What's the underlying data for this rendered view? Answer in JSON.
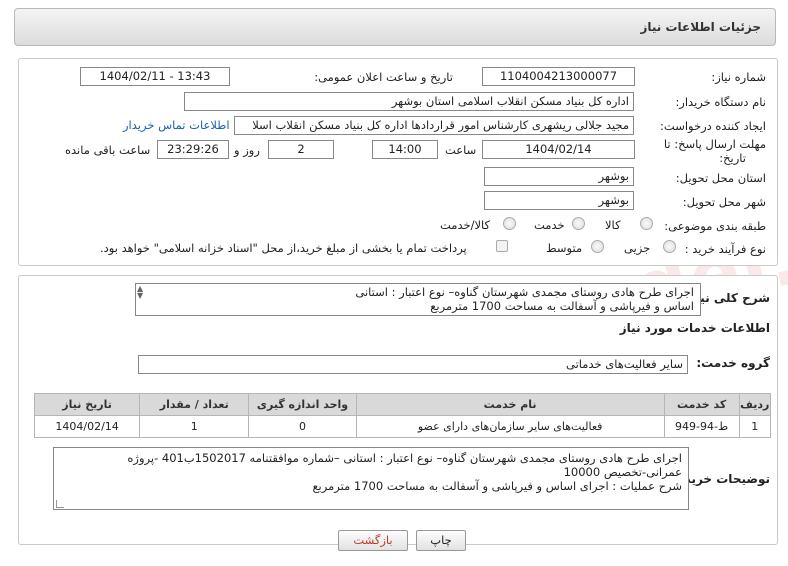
{
  "header": {
    "title": "جزئیات اطلاعات نیاز"
  },
  "form": {
    "need_number_label": "شماره نیاز:",
    "need_number": "1104004213000077",
    "announce_label": "تاریخ و ساعت اعلان عمومی:",
    "announce_value": "1404/02/11 - 13:43",
    "buyer_org_label": "نام دستگاه خریدار:",
    "buyer_org": "اداره کل بنیاد مسکن انقلاب اسلامی استان بوشهر",
    "creator_label": "ایجاد کننده درخواست:",
    "creator": "مجید جلالی ریشهری کارشناس امور قراردادها اداره کل بنیاد مسکن انقلاب اسلا",
    "contact_link": "اطلاعات تماس خریدار",
    "deadline_label": "مهلت ارسال پاسخ: تا",
    "deadline_label2": "تاریخ:",
    "deadline_date": "1404/02/14",
    "time_label": "ساعت",
    "deadline_time": "14:00",
    "days_value": "2",
    "days_label": "روز و",
    "remaining_time": "23:29:26",
    "remaining_label": "ساعت باقی مانده",
    "province_label": "استان محل تحویل:",
    "province": "بوشهر",
    "city_label": "شهر محل تحویل:",
    "city": "بوشهر",
    "category_label": "طبقه بندی موضوعی:",
    "category_options": [
      "کالا",
      "خدمت",
      "کالا/خدمت"
    ],
    "process_label": "نوع فرآیند خرید :",
    "process_options": [
      "جزیی",
      "متوسط"
    ],
    "payment_note": "پرداخت تمام یا بخشی از مبلغ خرید،از محل \"اسناد خزانه اسلامی\" خواهد بود."
  },
  "summary": {
    "label": "شرح کلی نیاز:",
    "line1": "اجرای طرح هادی روستای مجمدی  شهرستان گناوه– نوع اعتبار : استانی",
    "line2": "اساس و فیرپاشی و آسفالت به مساحت 1700 مترمربع"
  },
  "services": {
    "section_title": "اطلاعات خدمات مورد نیاز",
    "group_label": "گروه خدمت:",
    "group_value": "سایر فعالیت‌های خدماتی",
    "columns": [
      "ردیف",
      "کد خدمت",
      "نام خدمت",
      "واحد اندازه گیری",
      "تعداد / مقدار",
      "تاریخ نیاز"
    ],
    "rows": [
      {
        "row": "1",
        "code": "ط-94-949",
        "name": "فعالیت‌های سایر سازمان‌های دارای عضو",
        "unit": "0",
        "qty": "1",
        "date": "1404/02/14"
      }
    ]
  },
  "buyer_notes": {
    "label": "توضیحات خریدار:",
    "line1": "اجرای طرح هادی روستای مجمدی  شهرستان گناوه– نوع اعتبار : استانی –شماره موافقتنامه 1502017ب401 -پروژه",
    "line2": "عمرانی-تخصیص 10000",
    "line3": "شرح عملیات : اجرای اساس و فیرپاشی و آسفالت به مساحت 1700 مترمربع"
  },
  "buttons": {
    "print": "چاپ",
    "back": "بازگشت"
  },
  "colors": {
    "back_button_text": "#c0392b",
    "link": "#1a5fb4",
    "table_header": "#d9d9d9"
  }
}
